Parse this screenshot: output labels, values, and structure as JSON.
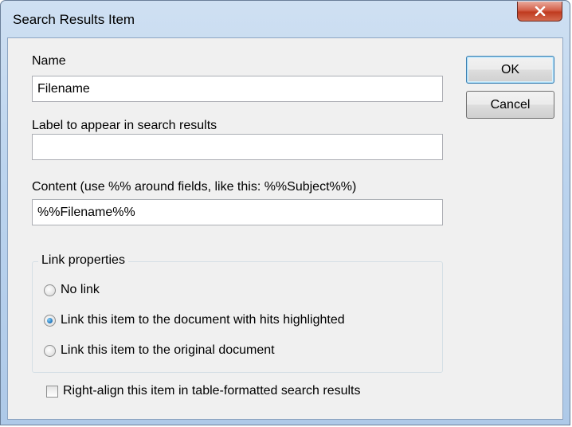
{
  "window": {
    "title": "Search Results Item"
  },
  "fields": {
    "name": {
      "label": "Name",
      "value": "Filename"
    },
    "label": {
      "label": "Label to appear in search results",
      "value": ""
    },
    "content": {
      "label": "Content (use %% around fields, like this: %%Subject%%)",
      "value": "%%Filename%%"
    }
  },
  "buttons": {
    "ok": "OK",
    "cancel": "Cancel"
  },
  "link_properties": {
    "legend": "Link properties",
    "options": [
      {
        "label": "No link",
        "selected": false
      },
      {
        "label": "Link this item to the document with hits highlighted",
        "selected": true
      },
      {
        "label": "Link this item to the original document",
        "selected": false
      }
    ]
  },
  "right_align": {
    "label": "Right-align this item in table-formatted search results",
    "checked": false
  },
  "icons": {
    "close": "close-icon"
  }
}
